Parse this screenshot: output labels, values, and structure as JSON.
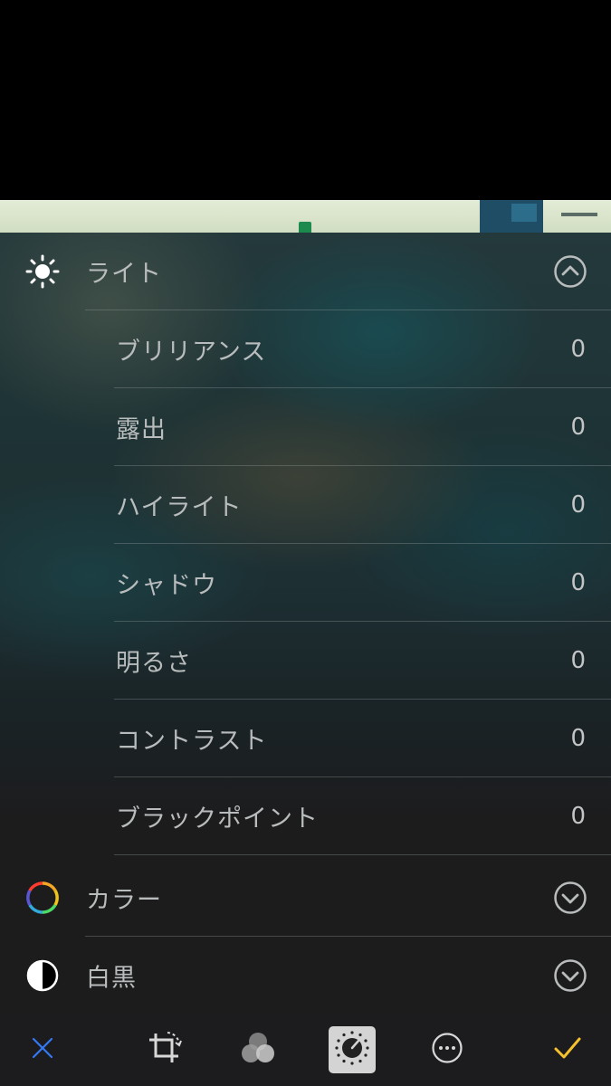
{
  "panel": {
    "light": {
      "label": "ライト",
      "icon": "sun-icon",
      "state": "expanded",
      "items": [
        {
          "label": "ブリリアンス",
          "value": "0"
        },
        {
          "label": "露出",
          "value": "0"
        },
        {
          "label": "ハイライト",
          "value": "0"
        },
        {
          "label": "シャドウ",
          "value": "0"
        },
        {
          "label": "明るさ",
          "value": "0"
        },
        {
          "label": "コントラスト",
          "value": "0"
        },
        {
          "label": "ブラックポイント",
          "value": "0"
        }
      ]
    },
    "color": {
      "label": "カラー",
      "icon": "color-wheel-icon",
      "state": "collapsed"
    },
    "bw": {
      "label": "白黒",
      "icon": "half-circle-icon",
      "state": "collapsed"
    }
  },
  "toolbar": {
    "items": [
      {
        "icon": "close-icon",
        "color": "#3478f6"
      },
      {
        "icon": "crop-rotate-icon"
      },
      {
        "icon": "filters-icon"
      },
      {
        "icon": "adjust-dial-icon",
        "active": true
      },
      {
        "icon": "more-icon"
      },
      {
        "icon": "checkmark-icon",
        "color": "#f5c12e"
      }
    ]
  },
  "colors": {
    "text": "#b9bcbd",
    "toolbar_bg": "#1c1c1e",
    "cancel": "#3478f6",
    "done": "#f5c12e",
    "active_tool_bg": "#d4d4d4"
  }
}
